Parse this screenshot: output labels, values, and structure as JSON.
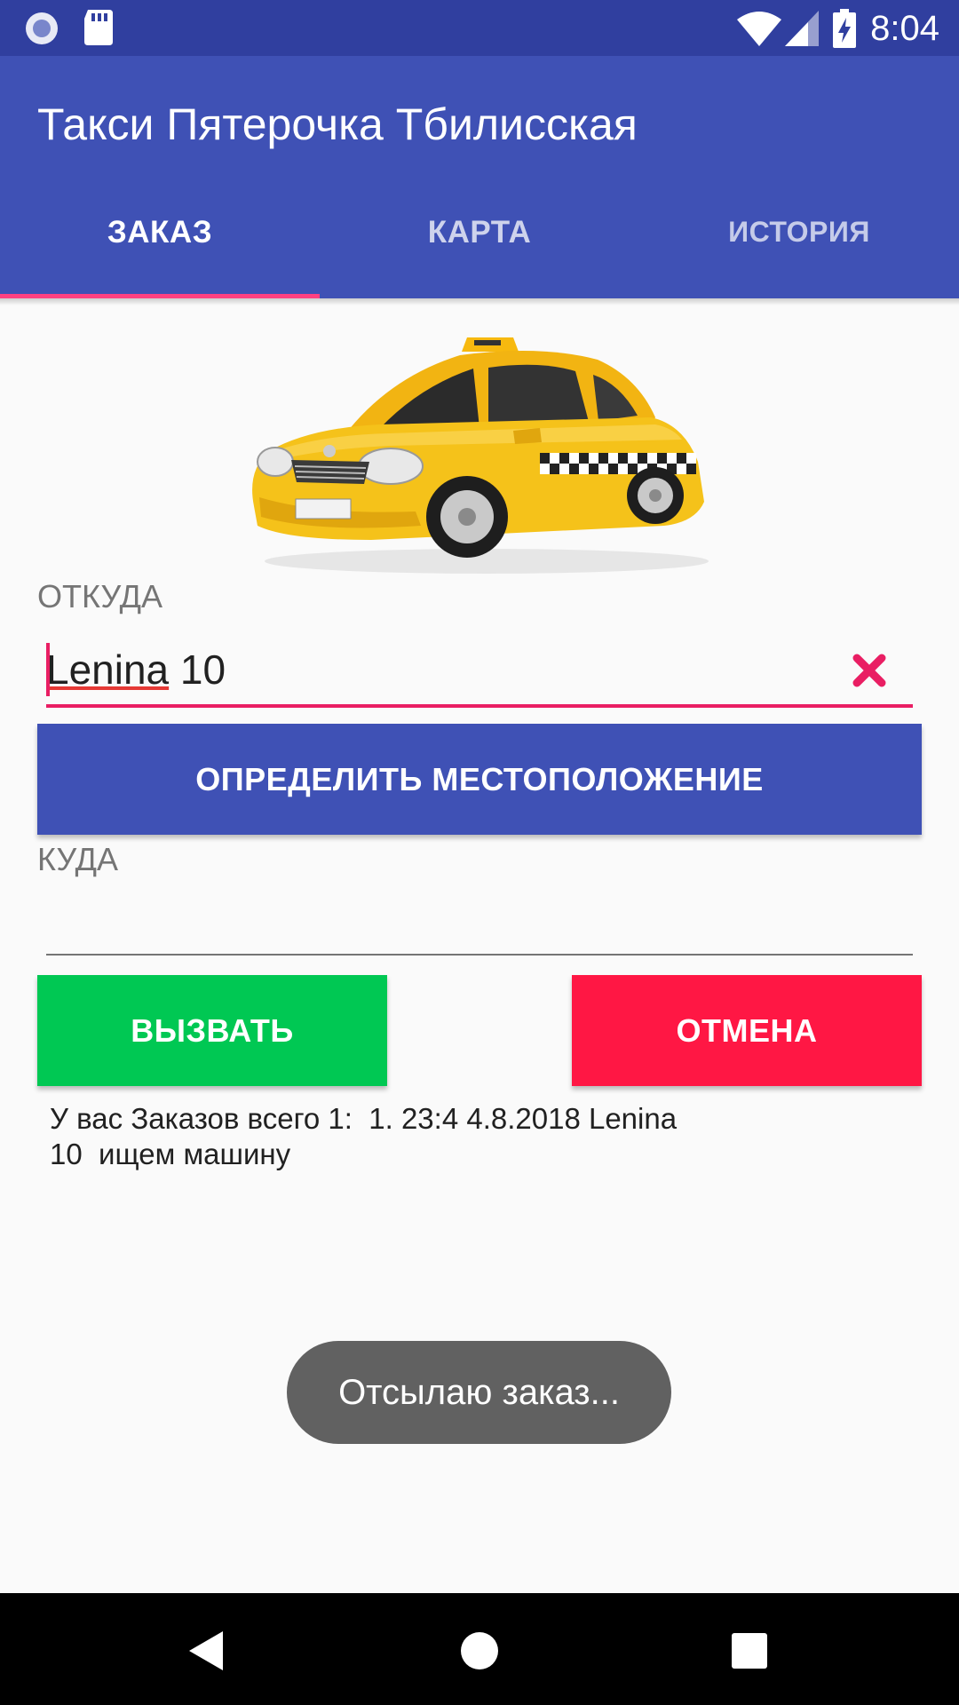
{
  "status_bar": {
    "time": "8:04",
    "left_icons": [
      "notification-icon",
      "sd-card-icon"
    ],
    "right_icons": [
      "wifi-icon",
      "signal-icon",
      "battery-charging-icon"
    ]
  },
  "app_bar": {
    "title": "Такси Пятерочка Тбилисская",
    "background_color": "#3f51b5",
    "status_color": "#303f9f"
  },
  "tabs": [
    {
      "label": "ЗАКАЗ",
      "selected": true
    },
    {
      "label": "КАРТА",
      "selected": false
    },
    {
      "label": "ИСТОРИЯ",
      "selected": false
    }
  ],
  "accent_color": "#ff4081",
  "form": {
    "from_label": "ОТКУДА",
    "from_value_word": "Lenina",
    "from_value_rest": " 10",
    "locate_button": "ОПРЕДЕЛИТЬ МЕСТОПОЛОЖЕНИЕ",
    "to_label": "КУДА",
    "to_value": "",
    "call_button": "ВЫЗВАТЬ",
    "cancel_button": "ОТМЕНА"
  },
  "orders_text": "У вас Заказов всего 1:  1. 23:4 4.8.2018 Lenina\n10  ищем машину",
  "toast": "Отсылаю заказ...",
  "colors": {
    "call": "#00c853",
    "cancel": "#ff1744",
    "clear_icon": "#e91e63"
  },
  "nav_bar": [
    "back-icon",
    "home-icon",
    "recents-icon"
  ]
}
